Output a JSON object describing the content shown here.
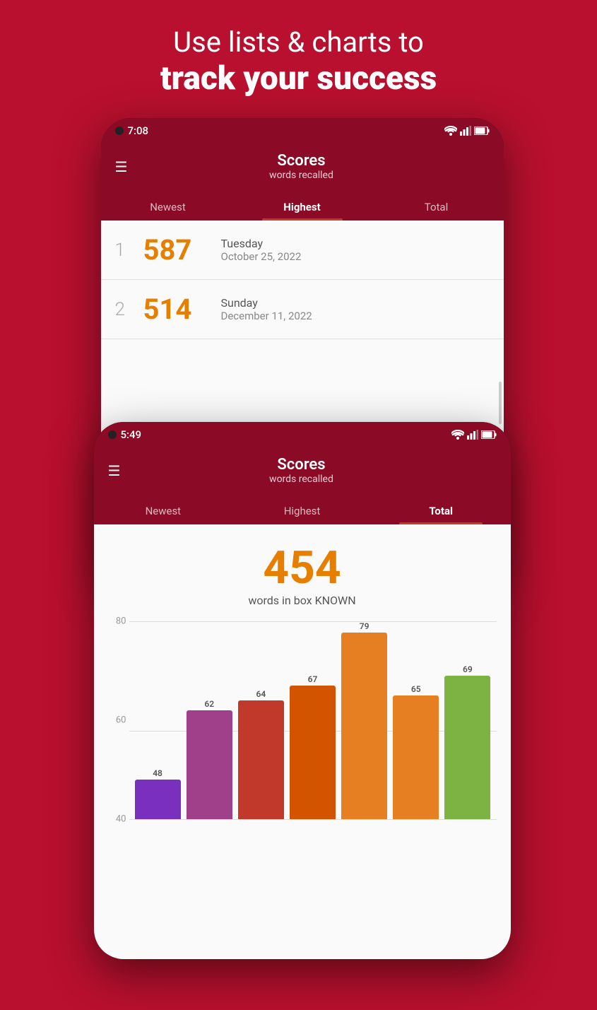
{
  "hero": {
    "line1": "Use lists & charts to",
    "line2": "track your success"
  },
  "phone1": {
    "time": "7:08",
    "title": "Scores",
    "subtitle": "words recalled",
    "tabs": [
      {
        "label": "Newest",
        "active": false
      },
      {
        "label": "Highest",
        "active": true
      },
      {
        "label": "Total",
        "active": false
      }
    ],
    "scores": [
      {
        "rank": "1",
        "value": "587",
        "day": "Tuesday",
        "date": "October 25, 2022"
      },
      {
        "rank": "2",
        "value": "514",
        "day": "Sunday",
        "date": "December 11, 2022"
      }
    ]
  },
  "phone2": {
    "time": "5:49",
    "title": "Scores",
    "subtitle": "words recalled",
    "tabs": [
      {
        "label": "Newest",
        "active": false
      },
      {
        "label": "Highest",
        "active": false
      },
      {
        "label": "Total",
        "active": true
      }
    ],
    "total": "454",
    "total_label": "words in box KNOWN",
    "chart": {
      "y_labels": [
        "80",
        "60",
        "40"
      ],
      "bars": [
        {
          "value": 48,
          "color": "#7b2fbe",
          "label": "48"
        },
        {
          "value": 62,
          "color": "#a0408a",
          "label": "62"
        },
        {
          "value": 64,
          "color": "#c0392b",
          "label": "64"
        },
        {
          "value": 67,
          "color": "#d35400",
          "label": "67"
        },
        {
          "value": 79,
          "color": "#e67e22",
          "label": "79"
        },
        {
          "value": 65,
          "color": "#e67e22",
          "label": "65"
        },
        {
          "value": 69,
          "color": "#7cb342",
          "label": "69"
        }
      ]
    }
  }
}
